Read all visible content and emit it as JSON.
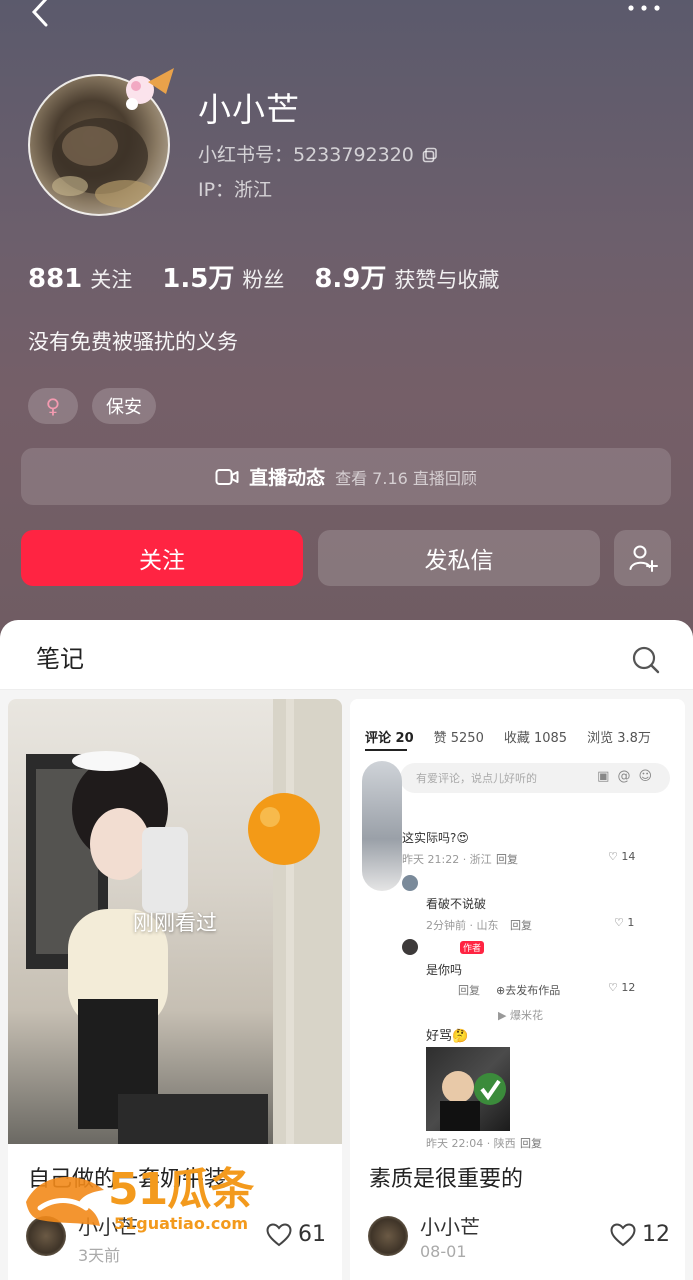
{
  "profile": {
    "name": "小小芒",
    "id_label": "小红书号：5233792320",
    "ip_label": "IP：浙江",
    "bio": "没有免费被骚扰的义务",
    "tags": [
      "♀",
      "保安"
    ]
  },
  "stats": [
    {
      "value": "881",
      "label": "关注"
    },
    {
      "value": "1.5万",
      "label": "粉丝"
    },
    {
      "value": "8.9万",
      "label": "获赞与收藏"
    }
  ],
  "live": {
    "title": "直播动态",
    "sub": "查看 7.16 直播回顾"
  },
  "actions": {
    "follow": "关注",
    "message": "发私信"
  },
  "section": {
    "title": "笔记"
  },
  "cards": [
    {
      "overlay": "刚刚看过",
      "title": "自己做的一套奶牛装",
      "author": "小小芒",
      "date": "3天前",
      "likes": "61"
    },
    {
      "title": "素质是很重要的",
      "author": "小小芒",
      "date": "08-01",
      "likes": "12"
    }
  ],
  "comment_shot": {
    "tabs": [
      "评论 20",
      "赞 5250",
      "收藏 1085",
      "浏览 3.8万"
    ],
    "placeholder": "有爱评论，说点儿好听的",
    "c1_text": "这实际吗?😍",
    "c1_meta": "昨天 21:22 · 浙江",
    "c1_reply": "回复",
    "c1_likes": "14",
    "c2_text": "看破不说破",
    "c2_meta": "2分钟前 · 山东",
    "c2_reply": "回复",
    "c2_likes": "1",
    "c3_badge": "作者",
    "c3_text": "是你吗",
    "c3_reply": "回复",
    "c3_publish": "⊕去发布作品",
    "c3_likes": "12",
    "c4_tag": "▶ 爆米花",
    "c4_text": "好骂🤔",
    "c5_meta": "昨天 22:04 · 陕西",
    "c5_reply": "回复"
  },
  "watermark": {
    "brand": "51瓜条",
    "url": "51guatiao.com"
  },
  "colors": {
    "accent": "#ff2442",
    "header": "#6a5d68"
  }
}
